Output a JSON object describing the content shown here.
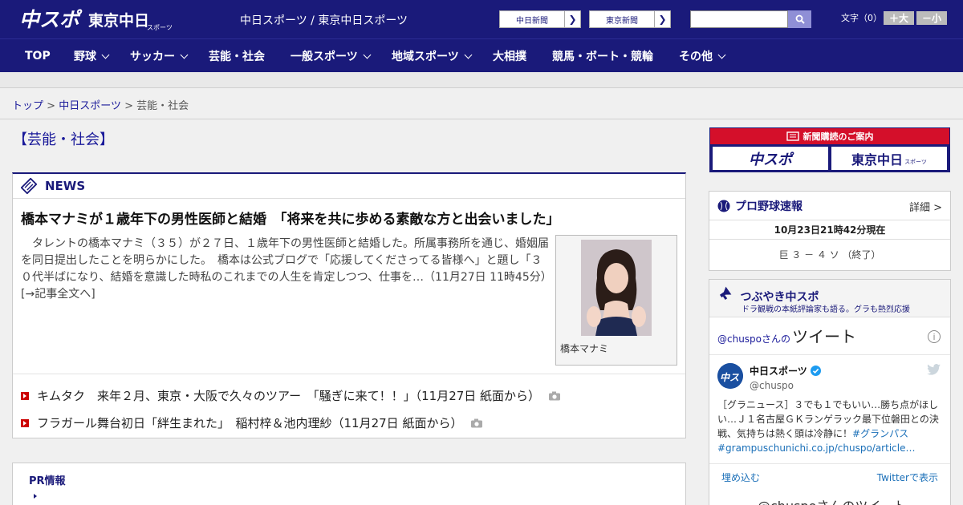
{
  "header": {
    "logo_chunichi": "中スポ",
    "logo_tokyo": "東京中日",
    "logo_tokyo_sub": "スポーツ",
    "site_names": "中日スポーツ / 東京中日スポーツ",
    "links": [
      {
        "label": "中日新聞"
      },
      {
        "label": "東京新聞"
      }
    ],
    "search": {
      "placeholder": "",
      "value": ""
    },
    "fontsize_label": "文字（0）",
    "fontsize_plus": "＋大",
    "fontsize_minus": "－小"
  },
  "nav": [
    {
      "label": "TOP",
      "has_menu": false
    },
    {
      "label": "野球",
      "has_menu": true
    },
    {
      "label": "サッカー",
      "has_menu": true
    },
    {
      "label": "芸能・社会",
      "has_menu": false
    },
    {
      "label": "一般スポーツ",
      "has_menu": true
    },
    {
      "label": "地域スポーツ",
      "has_menu": true
    },
    {
      "label": "大相撲",
      "has_menu": false
    },
    {
      "label": "競馬・ボート・競輪",
      "has_menu": false
    },
    {
      "label": "その他",
      "has_menu": true
    }
  ],
  "breadcrumb": {
    "top": "トップ",
    "sep": ">",
    "parent": "中日スポーツ",
    "current": "芸能・社会"
  },
  "section_title": "【芸能・社会】",
  "news": {
    "label": "NEWS",
    "headline": "橋本マナミが１歳年下の男性医師と結婚　「将来を共に歩める素敵な方と出会いました」",
    "lead": "　タレントの橋本マナミ（３５）が２７日、１歳年下の男性医師と結婚した。所属事務所を通じ、婚姻届を同日提出したことを明らかにした。　橋本は公式ブログで「応援してくださってる皆様へ」と題し「３０代半ばになり、結婚を意識した時私のこれまでの人生を肯定しつつ、仕事を…（11月27日 11時45分）　[→記事全文へ]",
    "photo_caption": "橋本マナミ",
    "items": [
      {
        "title": "キムタク　来年２月、東京・大阪で久々のツアー　「騒ぎに来て！！」（11月27日 紙面から）"
      },
      {
        "title": "フラガール舞台初日「絆生まれた」　稲村梓＆池内理紗（11月27日 紙面から）"
      }
    ]
  },
  "pr": {
    "label": "PR情報"
  },
  "sidebar": {
    "subscription": {
      "label": "新聞購読のご案内",
      "chunichi": "中スポ",
      "tokyo": "東京中日",
      "tokyo_sub": "スポーツ"
    },
    "baseball": {
      "title": "プロ野球速報",
      "more": "詳細 >",
      "time": "10月23日21時42分現在",
      "score": "巨 ３ － ４ ソ （終了）"
    },
    "tweets": {
      "title": "つぶやき中スポ",
      "subtitle": "ドラ観戦の本紙評論家も語る。グラも熱烈応援",
      "header_handle": "@chuspoさんの",
      "header_label": "ツイート",
      "name": "中日スポーツ",
      "handle": "@chuspo",
      "body": "［グラニュース］３でも１でもいい…勝ち点がほしい…Ｊ１名古屋ＧＫランゲラック最下位磐田との決戦、気持ちは熱く頭は冷静に！",
      "tag": "#グランパス",
      "link": "#grampuschunichi.co.jp/chuspo/article…",
      "embed": "埋め込む",
      "view": "Twitterで表示",
      "next": "@chuspoさんのツイート"
    }
  },
  "colors": {
    "brand_navy": "#1a1a7a",
    "accent_red": "#d40f2a",
    "link_blue": "#1a1a9a"
  }
}
